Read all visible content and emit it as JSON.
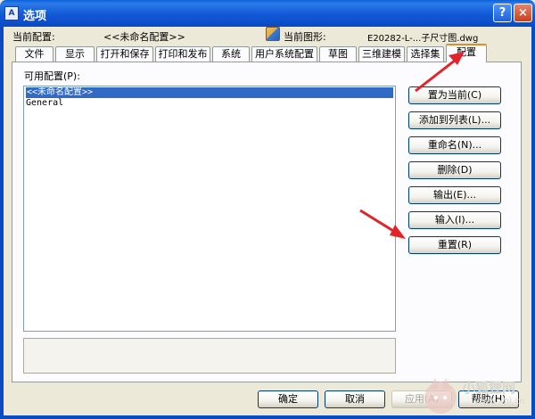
{
  "window": {
    "title": "选项",
    "help_label": "?",
    "close_label": "×"
  },
  "info": {
    "current_profile_label": "当前配置:",
    "current_profile_value": "<<未命名配置>>",
    "current_drawing_label": "当前图形:",
    "current_drawing_value": "E20282-L-...子尺寸图.dwg"
  },
  "tabs": [
    {
      "label": "文件"
    },
    {
      "label": "显示"
    },
    {
      "label": "打开和保存"
    },
    {
      "label": "打印和发布"
    },
    {
      "label": "系统"
    },
    {
      "label": "用户系统配置"
    },
    {
      "label": "草图"
    },
    {
      "label": "三维建模"
    },
    {
      "label": "选择集"
    },
    {
      "label": "配置"
    }
  ],
  "active_tab": "配置",
  "profiles": {
    "label": "可用配置(P):",
    "items": [
      {
        "label": "<<未命名配置>>",
        "selected": true
      },
      {
        "label": "General",
        "selected": false
      }
    ]
  },
  "side_buttons": {
    "set_current": "置为当前(C)",
    "add_to_list": "添加到列表(L)...",
    "rename": "重命名(N)...",
    "delete": "删除(D)",
    "export": "输出(E)...",
    "import": "输入(I)...",
    "reset": "重置(R)"
  },
  "footer": {
    "ok": "确定",
    "cancel": "取消",
    "apply": "应用(A)",
    "help": "帮助(H)"
  },
  "colors": {
    "titlebar": "#0a4bc4",
    "selection": "#316ac5",
    "annotation_arrow": "#e0242a"
  },
  "watermark": {
    "text": "小狐狸网",
    "subtext": "www.xhl.cn"
  }
}
